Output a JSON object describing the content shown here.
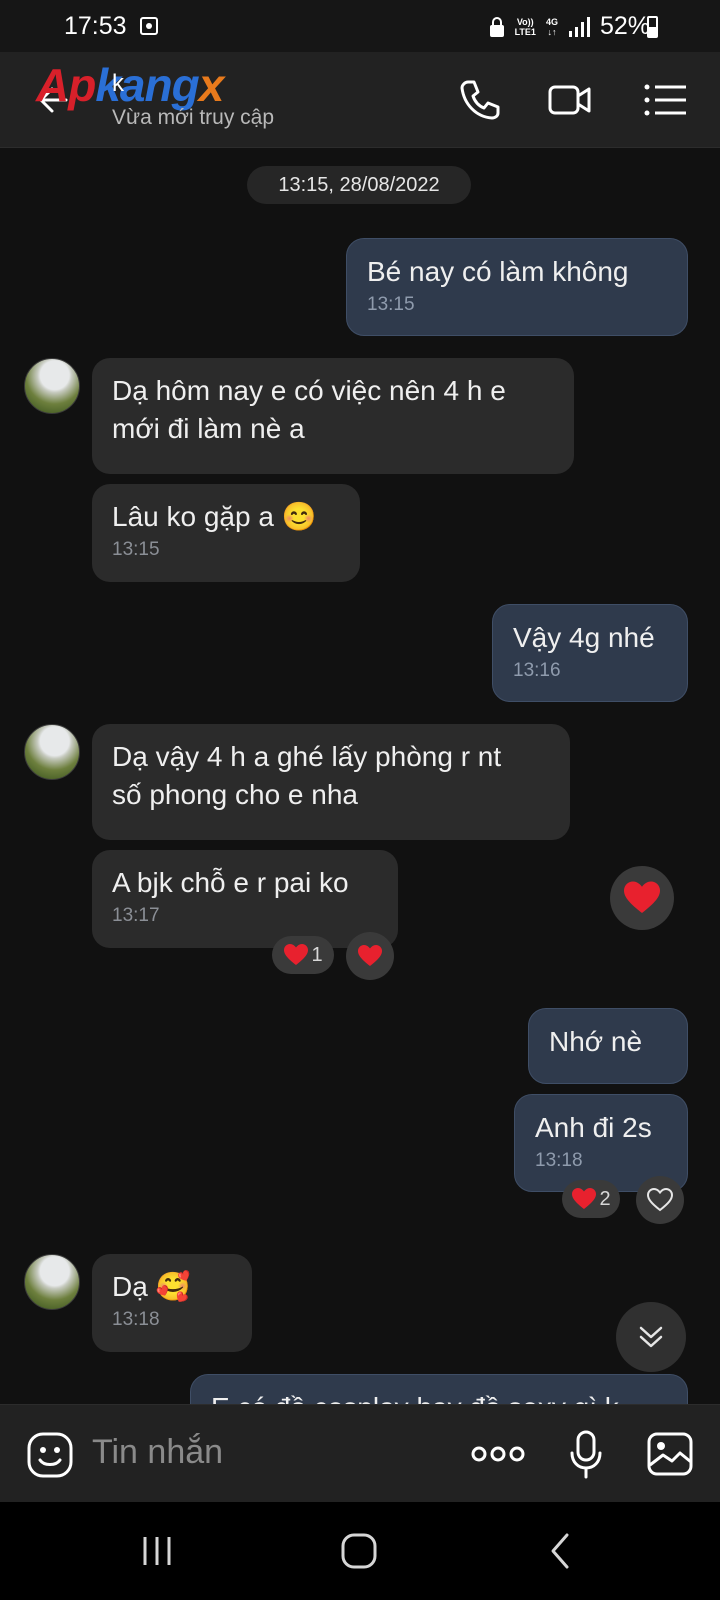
{
  "status_bar": {
    "time": "17:53",
    "network_top": "Vo))",
    "network_bottom": "LTE1",
    "network_type": "4G",
    "battery": "52%"
  },
  "header": {
    "watermark": "Apkangx",
    "contact_name": "k",
    "contact_status": "Vừa mới truy cập",
    "icons": [
      "back-arrow-icon",
      "phone-icon",
      "video-call-icon",
      "menu-icon"
    ]
  },
  "messages": {
    "date_chip": "13:15, 28/08/2022",
    "m1": {
      "text": "Bé nay có làm không",
      "time": "13:15"
    },
    "m2": {
      "line1": "Dạ hôm nay e có việc nên 4 h e",
      "line2": "mới đi làm nè a"
    },
    "m3": {
      "text": "Lâu ko gặp a 😊",
      "time": "13:15"
    },
    "m4": {
      "text": "Vậy 4g nhé",
      "time": "13:16"
    },
    "m5": {
      "line1": "Dạ vậy 4 h a ghé lấy phòng r nt",
      "line2": "số phong cho e nha"
    },
    "m6": {
      "text": "A bjk chỗ e r pai ko",
      "time": "13:17",
      "reaction_count": "1"
    },
    "m7": {
      "text": "Nhớ nè"
    },
    "m8": {
      "text": "Anh đi 2s",
      "time": "13:18",
      "reaction_count": "2"
    },
    "m9": {
      "text": "Dạ 🥰",
      "time": "13:18"
    },
    "m10_partial": "E có đồ cosplay hay đồ sexy gì k"
  },
  "composer": {
    "placeholder": "Tin nhắn",
    "icons": [
      "sticker-icon",
      "more-icon",
      "microphone-icon",
      "image-icon"
    ]
  },
  "colors": {
    "background": "#111111",
    "incoming_bubble": "#2b2b2b",
    "outgoing_bubble": "#2f3a4c",
    "heart": "#e8212e"
  }
}
